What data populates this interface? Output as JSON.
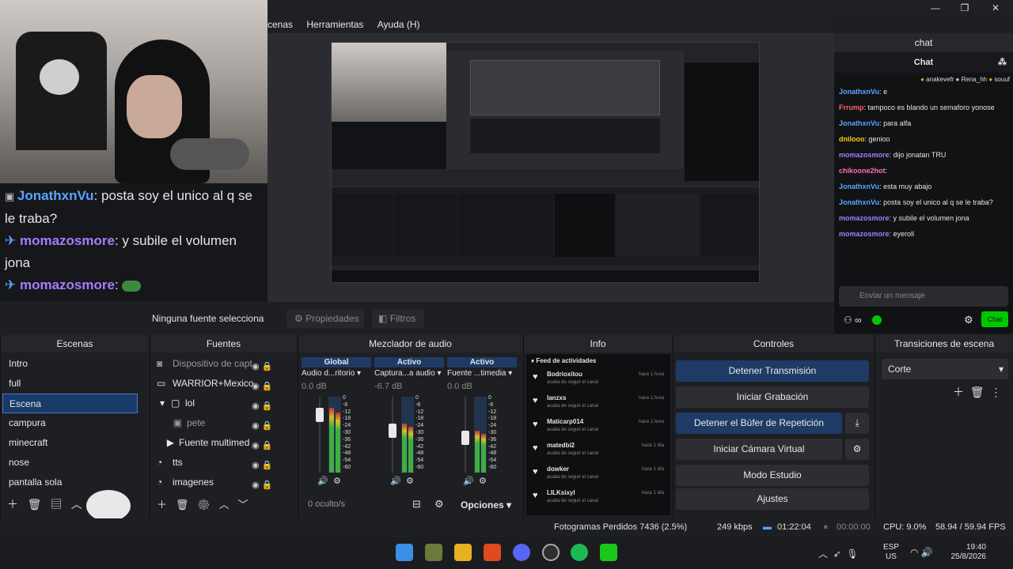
{
  "window": {
    "minimize": "—",
    "maximize": "❐",
    "close": "✕"
  },
  "menu": [
    "cenas",
    "Herramientas",
    "Ayuda (H)"
  ],
  "overlay_chat": [
    {
      "user": "JonathxnVu",
      "text": ": posta soy el unico al q se le traba?",
      "color": "blue"
    },
    {
      "user": "momazosmore",
      "text": ": y subile el volumen jona",
      "color": "purple"
    },
    {
      "user": "momazosmore",
      "text": ":",
      "color": "purple"
    }
  ],
  "status_row": {
    "no_source": "Ninguna fuente selecciona",
    "properties": "Propiedades",
    "filters": "Filtros"
  },
  "chat": {
    "dock_title": "chat",
    "header": "Chat",
    "top_users": [
      "anakevefr",
      "Rena_hh",
      "souuf"
    ],
    "messages": [
      {
        "user": "JonathxnVu",
        "text": ": e"
      },
      {
        "user": "Frrump",
        "text": ": tampoco es blando un semaforo yonose"
      },
      {
        "user": "JonathxnVu",
        "text": ": para alfa"
      },
      {
        "user": "dnilooo",
        "text": ": genioo"
      },
      {
        "user": "momazosmore",
        "text": ": dijo jonatan TRU"
      },
      {
        "user": "chikoone2hot",
        "text": ":"
      },
      {
        "user": "JonathxnVu",
        "text": ": esta muy abajo"
      },
      {
        "user": "JonathxnVu",
        "text": ": posta soy el unico al q se le traba?"
      },
      {
        "user": "momazosmore",
        "text": ": y subile el volumen jona"
      },
      {
        "user": "momazosmore",
        "text": ": eyeroll"
      }
    ],
    "input_placeholder": "Enviar un mensaje",
    "send_button": "Chat"
  },
  "scenes": {
    "title": "Escenas",
    "items": [
      "Intro",
      "full",
      "Escena",
      "campura",
      "minecraft",
      "nose",
      "pantalla sola"
    ],
    "selected": "Escena"
  },
  "sources": {
    "title": "Fuentes",
    "items": [
      "Dispositivo de capt",
      "WARRIOR+Mexico",
      "lol",
      "pete",
      "Fuente multimed",
      "tts",
      "imagenes"
    ]
  },
  "mixer": {
    "title": "Mezclador de audio",
    "channels": [
      {
        "tag": "Global",
        "name": "Audio d...ritorio",
        "db": "0.0 dB",
        "level": 0.85
      },
      {
        "tag": "Activo",
        "name": "Captura...a audio",
        "db": "-6.7 dB",
        "level": 0.65
      },
      {
        "tag": "Activo",
        "name": "Fuente ...timedia",
        "db": "0.0 dB",
        "level": 0.55
      }
    ],
    "scale": [
      "0",
      "-6",
      "-12",
      "-18",
      "-24",
      "-30",
      "-36",
      "-42",
      "-48",
      "-54",
      "-60"
    ],
    "hidden": "0 oculto/s",
    "options": "Opciones"
  },
  "info": {
    "title": "Info",
    "feed_title": "Feed de actividades",
    "events": [
      {
        "user": "Bodrioxitou",
        "desc": "acaba de seguir el canal",
        "time": "hace 1 hora"
      },
      {
        "user": "lanzxs",
        "desc": "acaba de seguir el canal",
        "time": "hace 1 hora"
      },
      {
        "user": "Maticarp014",
        "desc": "acaba de seguir el canal",
        "time": "hace 1 hora"
      },
      {
        "user": "matedbi2",
        "desc": "acaba de seguir el canal",
        "time": "hace 1 día"
      },
      {
        "user": "dowker",
        "desc": "acaba de seguir el canal",
        "time": "hace 1 día"
      },
      {
        "user": "LILKsixyl",
        "desc": "acaba de seguir el canal",
        "time": "hace 1 día"
      }
    ]
  },
  "controls": {
    "title": "Controles",
    "stop_stream": "Detener Transmisión",
    "start_record": "Iniciar Grabación",
    "stop_buffer": "Detener el Búfer de Repetición",
    "virtual_cam": "Iniciar Cámara Virtual",
    "studio_mode": "Modo Estudio",
    "settings": "Ajustes"
  },
  "transitions": {
    "title": "Transiciones de escena",
    "selected": "Corte"
  },
  "statusbar": {
    "dropped": "Fotogramas Perdidos 7436 (2.5%)",
    "bitrate": "249 kbps",
    "live_time": "01:22:04",
    "rec_time": "00:00:00",
    "cpu": "CPU: 9.0%",
    "fps": "58.94 / 59.94 FPS"
  },
  "taskbar": {
    "lang": "ESP",
    "region": "US",
    "time": "19:40",
    "date": "25/8/2026"
  },
  "colors": {
    "accent_blue": "#1e3b66",
    "twitch_purple": "#a77cff",
    "chat_green": "#00c800",
    "meter_green": "#3fae3f"
  }
}
